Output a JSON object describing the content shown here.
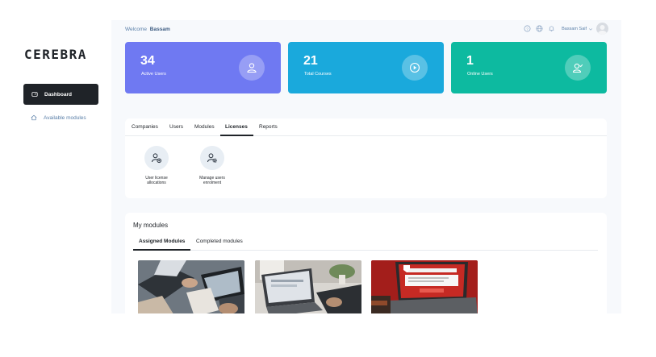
{
  "brand": {
    "logo_text": "CEREBRA"
  },
  "sidebar": {
    "items": [
      {
        "label": "Dashboard",
        "icon": "dashboard-gauge-icon",
        "active": true
      },
      {
        "label": "Available modules",
        "icon": "home-icon",
        "active": false
      }
    ]
  },
  "header": {
    "welcome_prefix": "Welcome",
    "welcome_name": "Bassam",
    "user_name": "Bassam Saif",
    "icons": [
      "help-icon",
      "globe-icon",
      "bell-icon",
      "chevron-down-icon",
      "avatar"
    ]
  },
  "stats": [
    {
      "value": "34",
      "label": "Active Users",
      "icon": "user-icon",
      "color": "#6f79f2"
    },
    {
      "value": "21",
      "label": "Total Courses",
      "icon": "play-icon",
      "color": "#1aa9dc"
    },
    {
      "value": "1",
      "label": "Online Users",
      "icon": "user-check-icon",
      "color": "#0dbaa0"
    }
  ],
  "tabs": {
    "items": [
      "Companies",
      "Users",
      "Modules",
      "Licenses",
      "Reports"
    ],
    "active": "Licenses"
  },
  "actions": [
    {
      "label_line1": "User license",
      "label_line2": "allocations",
      "icon": "user-license-icon"
    },
    {
      "label_line1": "Manage users",
      "label_line2": "enrolment",
      "icon": "manage-users-icon"
    }
  ],
  "modules": {
    "title": "My modules",
    "tabs": [
      "Assigned Modules",
      "Completed modules"
    ],
    "active_tab": "Assigned Modules",
    "thumbnails": [
      {
        "name": "module-thumbnail-tablets"
      },
      {
        "name": "module-thumbnail-laptop-desk"
      },
      {
        "name": "module-thumbnail-ransomware"
      }
    ]
  }
}
